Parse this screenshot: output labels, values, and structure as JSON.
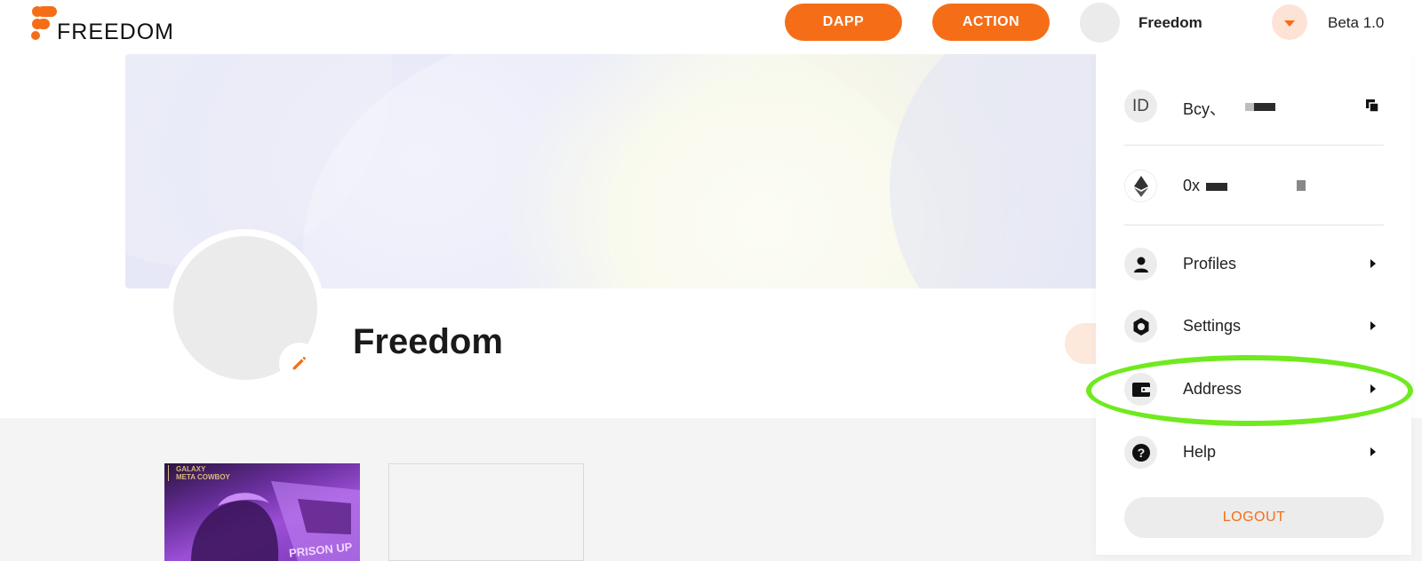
{
  "header": {
    "logo_text": "FREEDOM",
    "dapp_label": "DAPP",
    "action_label": "ACTION",
    "user_name": "Freedom",
    "version": "Beta 1.0"
  },
  "profile": {
    "name": "Freedom"
  },
  "nfts": [
    {
      "tag_line1": "GALAXY",
      "tag_line2": "META COWBOY",
      "overlay": "PRISON UP"
    }
  ],
  "menu": {
    "id_icon": "ID",
    "id_value": "Bcy、",
    "eth_value": "0x",
    "items": [
      {
        "label": "Profiles",
        "icon": "person-icon"
      },
      {
        "label": "Settings",
        "icon": "gear-icon"
      },
      {
        "label": "Address",
        "icon": "wallet-icon"
      },
      {
        "label": "Help",
        "icon": "help-icon"
      }
    ],
    "logout_label": "LOGOUT"
  },
  "colors": {
    "accent": "#f56e17",
    "highlight": "#6fea1f"
  }
}
